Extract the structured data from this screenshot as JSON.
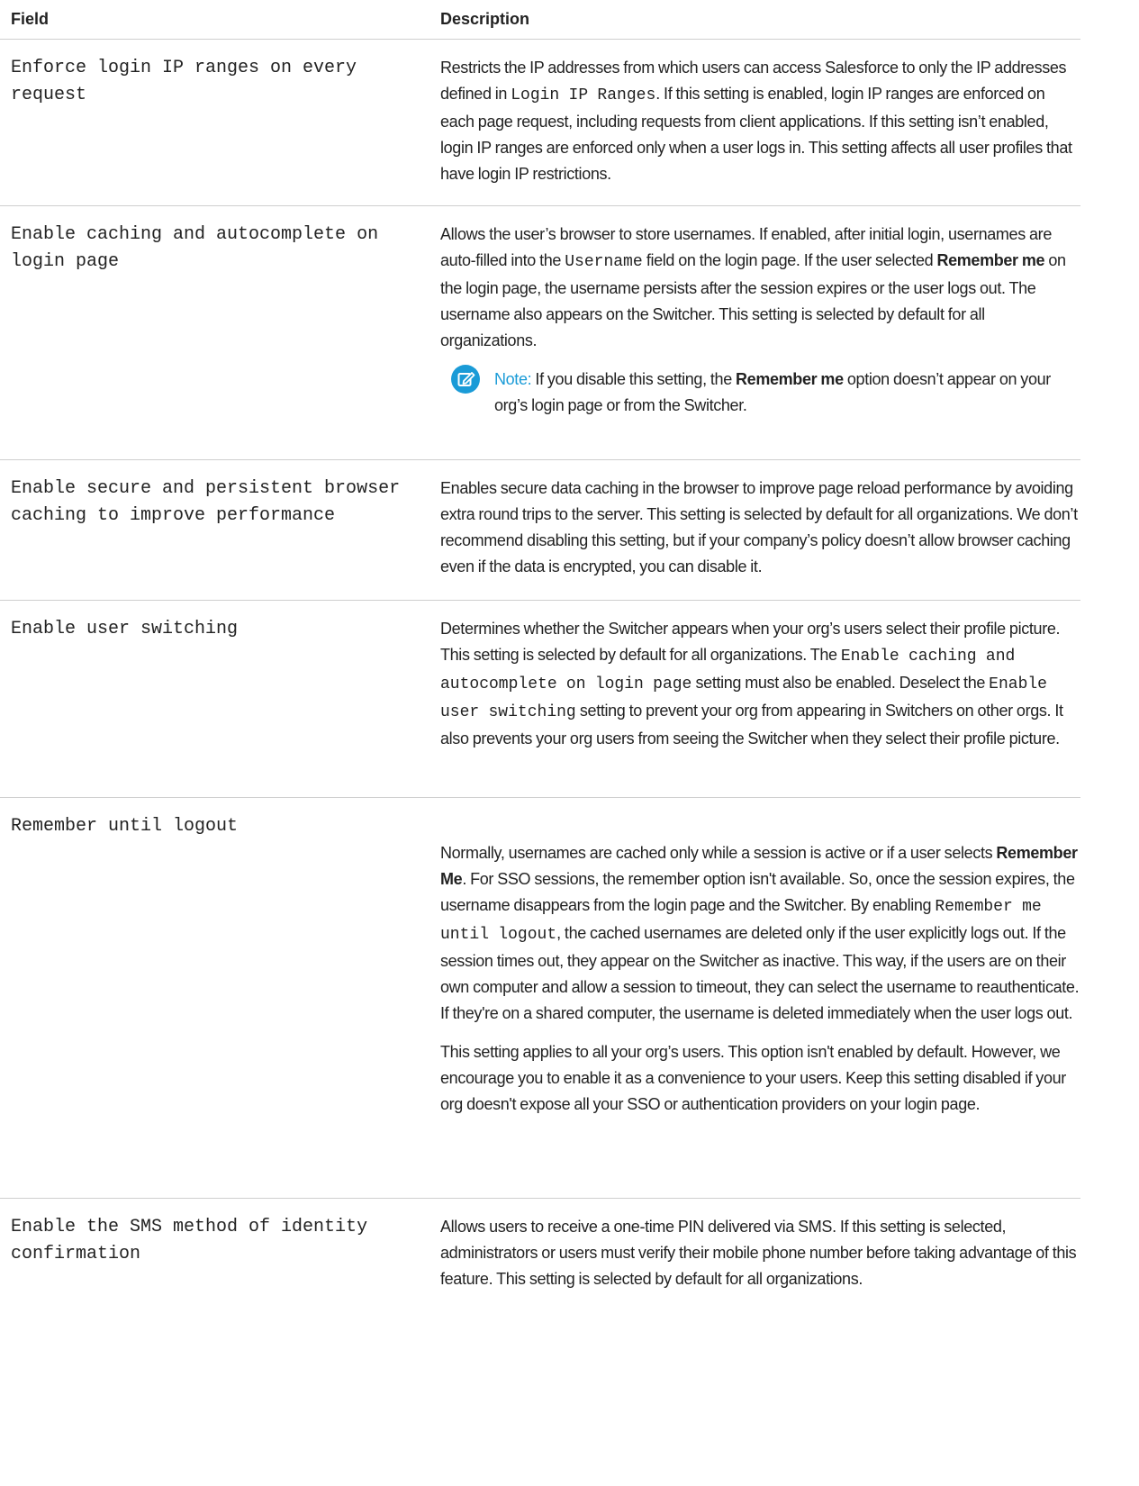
{
  "header": {
    "field": "Field",
    "description": "Description"
  },
  "rows": [
    {
      "field": "Enforce login IP ranges on every request",
      "desc": {
        "t1": "Restricts the IP addresses from which users can access Salesforce to only the IP addresses defined in ",
        "code1": "Login IP Ranges",
        "t2": ". If this setting is enabled, login IP ranges are enforced on each page request, including requests from client applications. If this setting isn’t enabled, login IP ranges are enforced only when a user logs in. This setting affects all user profiles that have login IP restrictions."
      }
    },
    {
      "field": "Enable caching and autocomplete on login page",
      "desc": {
        "t1": "Allows the user’s browser to store usernames. If enabled, after initial login, usernames are auto-filled into the ",
        "code1": "Username",
        "t2": " field on the login page. If the user selected ",
        "bold1": "Remember me",
        "t3": " on the login page, the username persists after the session expires or the user logs out. The username also appears on the Switcher. This setting is selected by default for all organizations."
      },
      "note": {
        "icon": "note-edit-icon",
        "label": "Note:",
        "t1": " If you disable this setting, the ",
        "bold1": "Remember me",
        "t2": " option doesn’t appear on your org’s login page or from the Switcher."
      }
    },
    {
      "field": "Enable secure and persistent browser caching to improve performance",
      "desc": {
        "t1": "Enables secure data caching in the browser to improve page reload performance by avoiding extra round trips to the server. This setting is selected by default for all organizations. We don’t recommend disabling this setting, but if your company’s policy doesn’t allow browser caching even if the data is encrypted, you can disable it."
      }
    },
    {
      "field": "Enable user switching",
      "desc": {
        "t1": "Determines whether the Switcher appears when your org’s users select their profile picture. This setting is selected by default for all organizations. The ",
        "code1": "Enable caching and autocomplete on login page",
        "t2": " setting must also be enabled. Deselect the ",
        "code2": "Enable user switching",
        "t3": " setting to prevent your org from appearing in Switchers on other orgs. It also prevents your org users from seeing the Switcher when they select their profile picture."
      }
    },
    {
      "field": "Remember until logout",
      "desc": {
        "t1": "Normally, usernames are cached only while a session is active or if a user selects ",
        "bold1": "Remember Me",
        "t2": ". For SSO sessions, the remember option isn't available. So, once the session expires, the username disappears from the login page and the Switcher. By enabling ",
        "code1": "Remember me until logout",
        "t3": ", the cached usernames are deleted only if the user explicitly logs out. If the session times out, they appear on the Switcher as inactive. This way, if the users are on their own computer and allow a session to timeout, they can select the username to reauthenticate. If they're on a shared computer, the username is deleted immediately when the user logs out.",
        "p2": "This setting applies to all your org’s users. This option isn't enabled by default. However, we encourage you to enable it as a convenience to your users. Keep this setting disabled if your org doesn't expose all your SSO or authentication providers on your login page."
      }
    },
    {
      "field": "Enable the SMS method of identity confirmation",
      "desc": {
        "t1": "Allows users to receive a one-time PIN delivered via SMS. If this setting is selected, administrators or users must verify their mobile phone number before taking advantage of this feature. This setting is selected by default for all organizations."
      }
    }
  ],
  "colors": {
    "note_accent": "#1a9bd7",
    "divider": "#cfcfcf",
    "text": "#222222"
  }
}
